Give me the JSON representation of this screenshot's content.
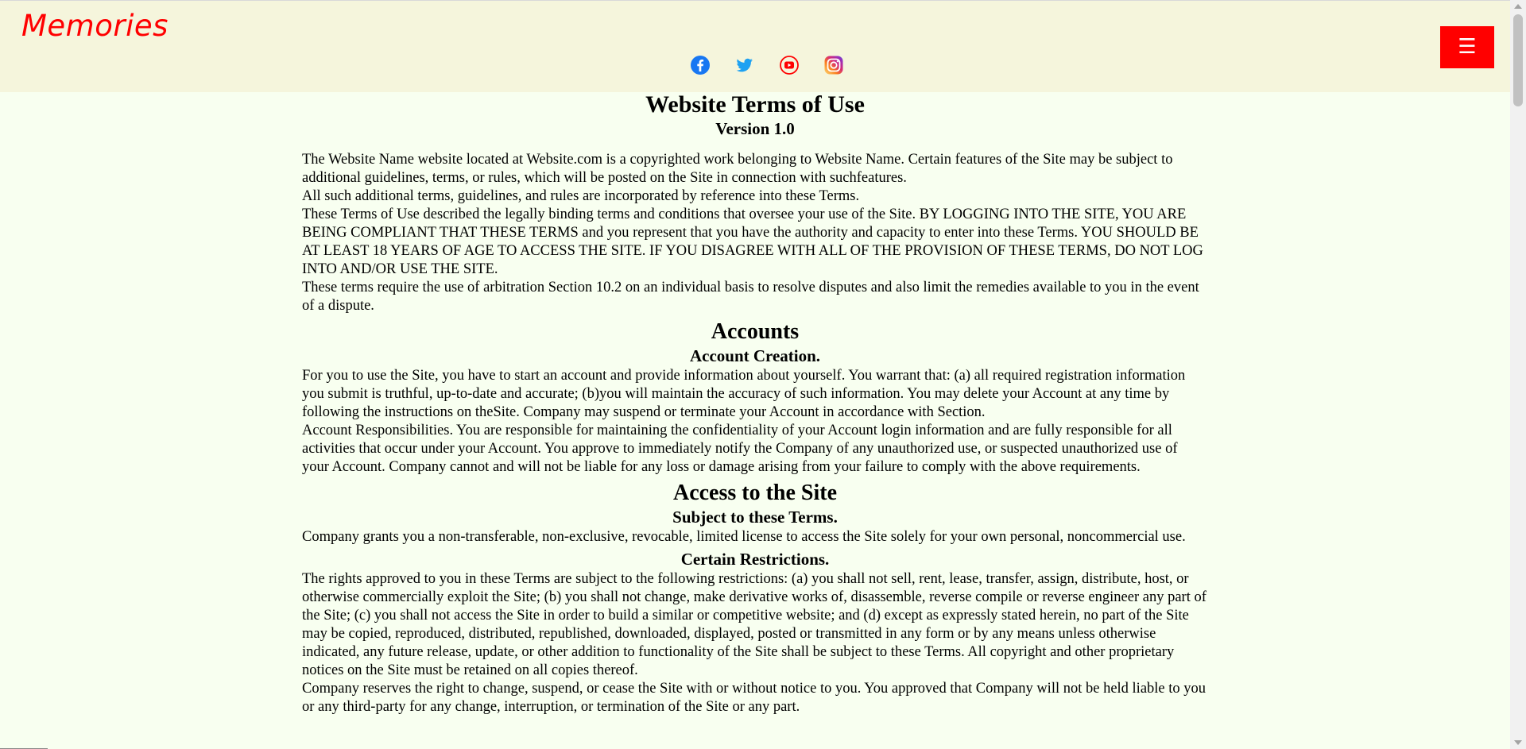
{
  "header": {
    "logo": "Memories",
    "socials": [
      {
        "icon": "facebook-icon",
        "color": "#1877f2"
      },
      {
        "icon": "twitter-icon",
        "color": "#1da1f2"
      },
      {
        "icon": "youtube-icon",
        "color": "#ff0000"
      },
      {
        "icon": "instagram-icon",
        "color": "#e1306c"
      }
    ],
    "menu_label": "☰",
    "colors": {
      "background": "#f5f5dc",
      "logo": "#ff0000",
      "menu_button": "#ff0000"
    }
  },
  "terms": {
    "title": "Website Terms of Use",
    "version": "Version 1.0",
    "intro": [
      "The Website Name website located at Website.com is a copyrighted work belonging to Website Name. Certain features of the Site may be subject to additional guidelines, terms, or rules, which will be posted on the Site in connection with suchfeatures.",
      "All such additional terms, guidelines, and rules are incorporated by reference into these Terms.",
      "These Terms of Use described the legally binding terms and conditions that oversee your use of the Site. BY LOGGING INTO THE SITE, YOU ARE BEING COMPLIANT THAT THESE TERMS and you represent that you have the authority and capacity to enter into these Terms. YOU SHOULD BE AT LEAST 18 YEARS OF AGE TO ACCESS THE SITE. IF YOU DISAGREE WITH ALL OF THE PROVISION OF THESE TERMS, DO NOT LOG INTO AND/OR USE THE SITE.",
      "These terms require the use of arbitration Section 10.2 on an individual basis to resolve disputes and also limit the remedies available to you in the event of a dispute."
    ],
    "accounts": {
      "heading": "Accounts",
      "subheading": "Account Creation.",
      "paragraphs": [
        "For you to use the Site, you have to start an account and provide information about yourself. You warrant that: (a) all required registration information you submit is truthful, up-to-date and accurate; (b)you will maintain the accuracy of such information. You may delete your Account at any time by following the instructions on theSite. Company may suspend or terminate your Account in accordance with Section.",
        "Account Responsibilities. You are responsible for maintaining the confidentiality of your Account login information and are fully responsible for all activities that occur under your Account. You approve to immediately notify the Company of any unauthorized use, or suspected unauthorized use of your Account. Company cannot and will not be liable for any loss or damage arising from your failure to comply with the above requirements."
      ]
    },
    "access": {
      "heading": "Access to the Site",
      "subheading": "Subject to these Terms.",
      "paragraph": "Company grants you a non-transferable, non-exclusive, revocable, limited license to access the Site solely for your own personal, noncommercial use.",
      "restrictions_heading": "Certain Restrictions.",
      "restrictions_paragraphs": [
        "The rights approved to you in these Terms are subject to the following restrictions: (a) you shall not sell, rent, lease, transfer, assign, distribute, host, or otherwise commercially exploit the Site; (b) you shall not change, make derivative works of, disassemble, reverse compile or reverse engineer any part of the Site; (c) you shall not access the Site in order to build a similar or competitive website; and (d) except as expressly stated herein, no part of the Site may be copied, reproduced, distributed, republished, downloaded, displayed, posted or transmitted in any form or by any means unless otherwise indicated, any future release, update, or other addition to functionality of the Site shall be subject to these Terms. All copyright and other proprietary notices on the Site must be retained on all copies thereof.",
        "Company reserves the right to change, suspend, or cease the Site with or without notice to you. You approved that Company will not be held liable to you or any third-party for any change, interruption, or termination of the Site or any part."
      ]
    }
  }
}
